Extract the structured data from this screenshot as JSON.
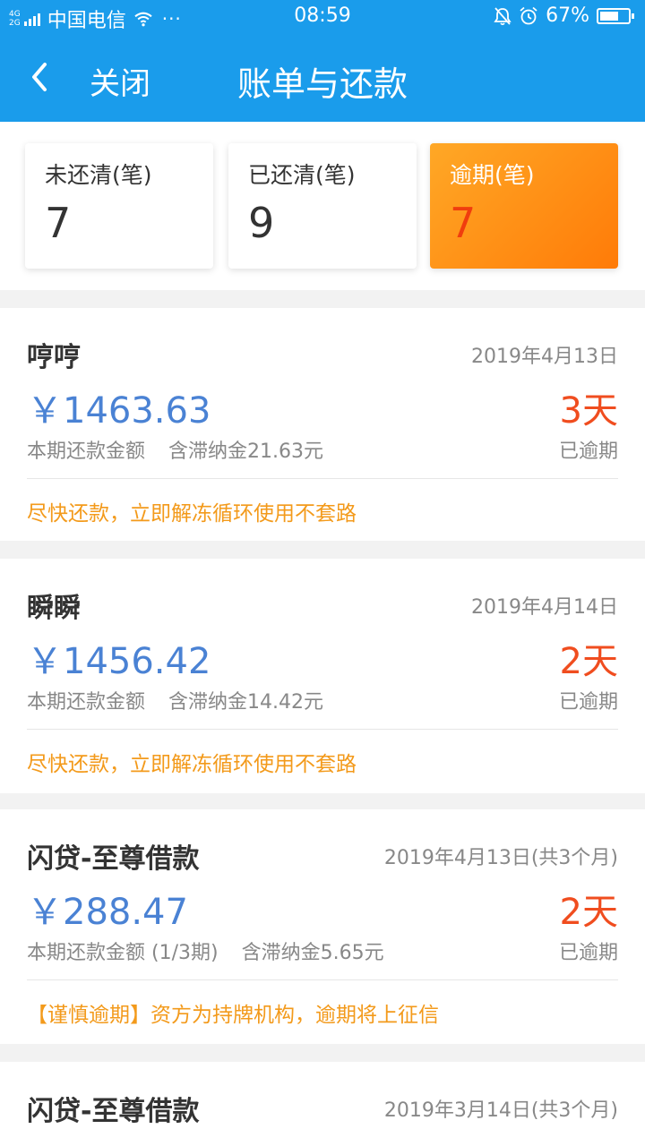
{
  "status_bar": {
    "network": [
      "4G",
      "2G"
    ],
    "carrier": "中国电信",
    "more": "···",
    "time": "08:59",
    "battery": "67%",
    "battery_level": 0.67
  },
  "nav": {
    "close_label": "关闭",
    "title": "账单与还款"
  },
  "summary": [
    {
      "label": "未还清(笔)",
      "value": "7"
    },
    {
      "label": "已还清(笔)",
      "value": "9"
    },
    {
      "label": "逾期(笔)",
      "value": "7"
    }
  ],
  "bills": [
    {
      "name": "哼哼",
      "date": "2019年4月13日",
      "amount": "￥1463.63",
      "days": "3天",
      "amount_label": "本期还款金额",
      "fee": "含滞纳金21.63元",
      "status": "已逾期",
      "tip": "尽快还款，立即解冻循环使用不套路"
    },
    {
      "name": "瞬瞬",
      "date": "2019年4月14日",
      "amount": "￥1456.42",
      "days": "2天",
      "amount_label": "本期还款金额",
      "fee": "含滞纳金14.42元",
      "status": "已逾期",
      "tip": "尽快还款，立即解冻循环使用不套路"
    },
    {
      "name": "闪贷-至尊借款",
      "date": "2019年4月13日(共3个月)",
      "amount": "￥288.47",
      "days": "2天",
      "amount_label": "本期还款金额 (1/3期)",
      "fee": "含滞纳金5.65元",
      "status": "已逾期",
      "tip": "【谨慎逾期】资方为持牌机构，逾期将上征信"
    },
    {
      "name": "闪贷-至尊借款",
      "date": "2019年3月14日(共3个月)",
      "amount": "",
      "days": "",
      "amount_label": "",
      "fee": "",
      "status": "",
      "tip": ""
    }
  ],
  "colors": {
    "header": "#1a9ceb",
    "amount": "#4a82d4",
    "overdue": "#f04d1f",
    "tip": "#f39a1b",
    "overdue_card": "#ff8a12"
  }
}
